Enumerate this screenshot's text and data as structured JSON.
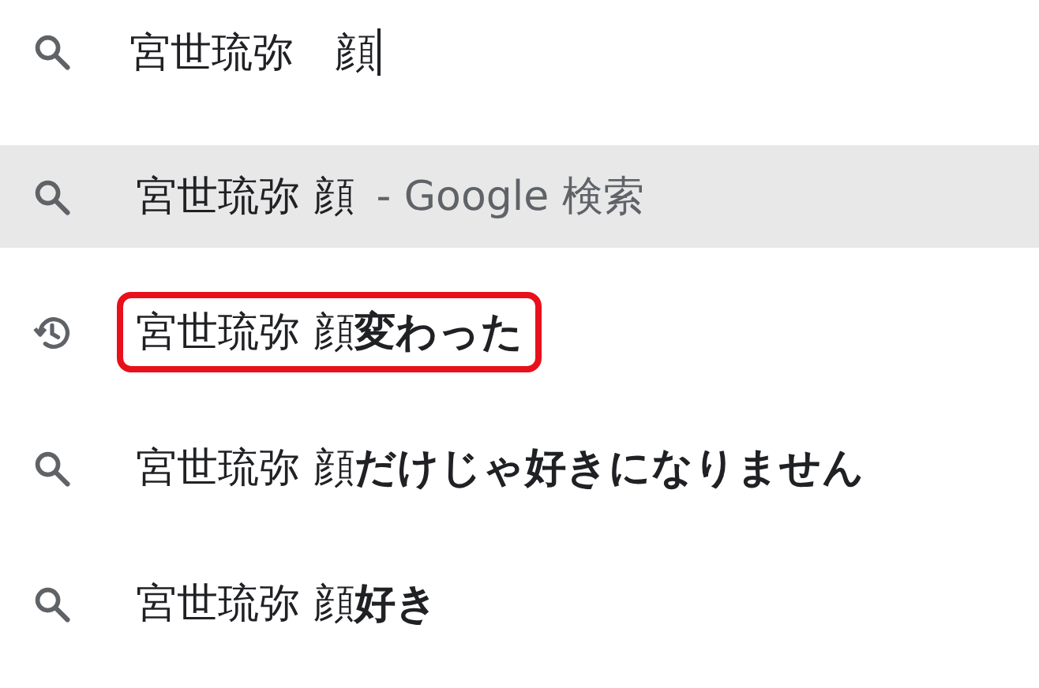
{
  "search": {
    "value": "宮世琉弥　顔"
  },
  "suggestions": [
    {
      "kind": "search",
      "text": "宮世琉弥 顔",
      "suffix": "- Google 検索",
      "selected": true,
      "highlighted": false
    },
    {
      "kind": "history",
      "text": "宮世琉弥 顔**変わった**",
      "selected": false,
      "highlighted": true
    },
    {
      "kind": "search",
      "text": "宮世琉弥 顔**だけじゃ好きになりません**",
      "selected": false,
      "highlighted": false
    },
    {
      "kind": "search",
      "text": "宮世琉弥 顔**好き**",
      "selected": false,
      "highlighted": false
    }
  ]
}
